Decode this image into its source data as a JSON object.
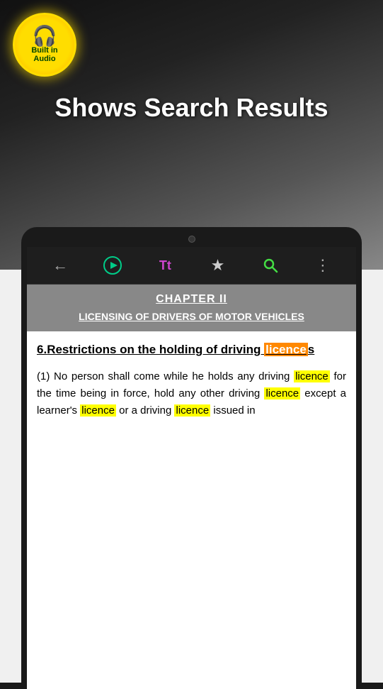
{
  "app": {
    "title": "Shows Search Results"
  },
  "audio_badge": {
    "icon": "🎧",
    "line1": "Built in",
    "line2": "Audio"
  },
  "toolbar": {
    "back_label": "←",
    "play_label": "▶",
    "text_label": "Tt",
    "bookmark_label": "★",
    "search_label": "🔍",
    "more_label": "⋮"
  },
  "chapter": {
    "title": "CHAPTER II",
    "subtitle": "LICENSING OF DRIVERS OF MOTOR VEHICLES"
  },
  "section": {
    "number": "6.",
    "heading_part1": "Restrictions on the holding of driving ",
    "heading_highlight": "licence",
    "heading_suffix": "s"
  },
  "body": {
    "text_start": "(1)  No person shall come while he holds any driving ",
    "highlight1": "licence",
    "text_mid1": " for the time being in force,  hold  any  other driving ",
    "highlight2": "licence",
    "text_mid2": " except a learner's ",
    "highlight3": "licence",
    "text_end": " or a driving ",
    "highlight4": "licence",
    "text_final": "            issued    in"
  }
}
